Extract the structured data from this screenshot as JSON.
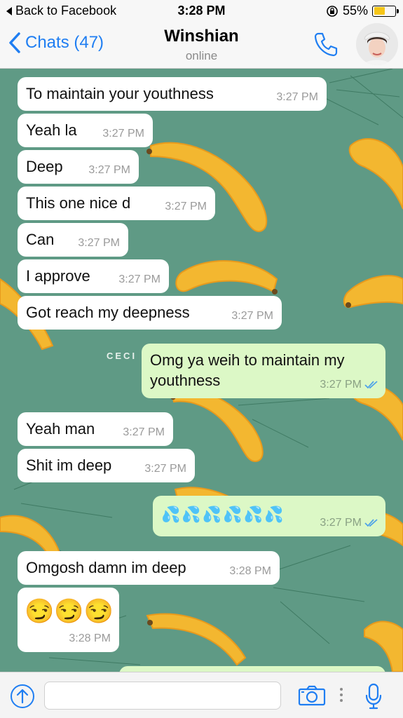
{
  "status_bar": {
    "back_app": "Back to Facebook",
    "time": "3:28 PM",
    "battery_percent": "55%",
    "battery_level": 0.55
  },
  "nav": {
    "back_label": "Chats (47)",
    "title": "Winshian",
    "subtitle": "online"
  },
  "background_text": "CECI",
  "messages": [
    {
      "dir": "in",
      "text": "To maintain your youthness",
      "time": "3:27 PM"
    },
    {
      "dir": "in",
      "text": "Yeah la",
      "time": "3:27 PM"
    },
    {
      "dir": "in",
      "text": "Deep",
      "time": "3:27 PM"
    },
    {
      "dir": "in",
      "text": "This one nice d",
      "time": "3:27 PM"
    },
    {
      "dir": "in",
      "text": "Can",
      "time": "3:27 PM"
    },
    {
      "dir": "in",
      "text": "I approve",
      "time": "3:27 PM"
    },
    {
      "dir": "in",
      "text": "Got reach my deepness",
      "time": "3:27 PM"
    },
    {
      "dir": "out",
      "text": "Omg ya weih to maintain my youthness",
      "time": "3:27 PM",
      "status": "read"
    },
    {
      "dir": "in",
      "text": "Yeah man",
      "time": "3:27 PM"
    },
    {
      "dir": "in",
      "text": "Shit im deep",
      "time": "3:27 PM"
    },
    {
      "dir": "out",
      "text": "💦💦💦💦💦💦",
      "time": "3:27 PM",
      "status": "read"
    },
    {
      "dir": "in",
      "text": "Omgosh damn im deep",
      "time": "3:28 PM"
    },
    {
      "dir": "in",
      "text": "😏😏😏",
      "time": "3:28 PM"
    }
  ],
  "input": {
    "placeholder": ""
  },
  "colors": {
    "accent": "#1f7ef2",
    "chat_bg": "#5f9a85",
    "outgoing": "#dcf8c6",
    "incoming": "#ffffff",
    "banana": "#f3b730",
    "read_ticks": "#4fa3e8"
  },
  "icons": {
    "back_app": "back-triangle-icon",
    "lock": "rotation-lock-icon",
    "battery": "battery-icon",
    "back": "chevron-left-icon",
    "call": "phone-icon",
    "upload": "upload-arrow-icon",
    "camera": "camera-icon",
    "more": "vertical-dots-icon",
    "mic": "microphone-icon",
    "read": "double-check-icon"
  }
}
